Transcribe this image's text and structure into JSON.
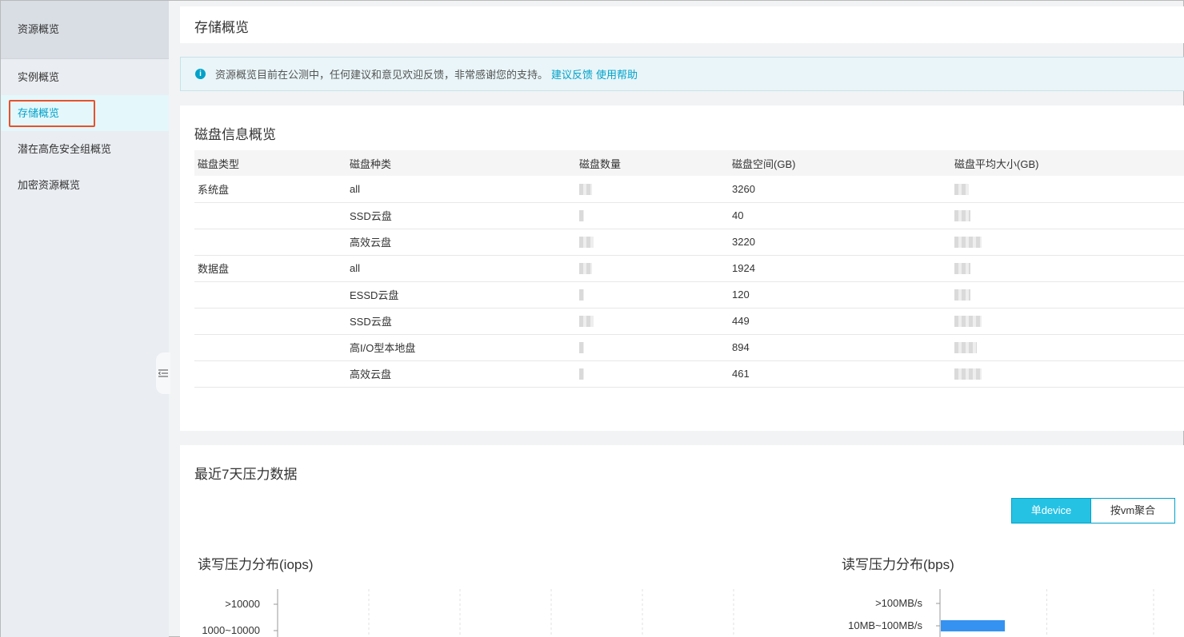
{
  "sidebar": {
    "title": "资源概览",
    "items": [
      {
        "label": "实例概览"
      },
      {
        "label": "存储概览"
      },
      {
        "label": "潜在高危安全组概览"
      },
      {
        "label": "加密资源概览"
      }
    ]
  },
  "page": {
    "title": "存储概览",
    "notice": {
      "text": "资源概览目前在公测中，任何建议和意见欢迎反馈，非常感谢您的支持。",
      "link1": "建议反馈",
      "link2": "使用帮助"
    }
  },
  "disk_overview": {
    "title": "磁盘信息概览",
    "headers": [
      "磁盘类型",
      "磁盘种类",
      "磁盘数量",
      "磁盘空间(GB)",
      "磁盘平均大小(GB)"
    ],
    "rows": [
      {
        "type": "系统盘",
        "kind": "all",
        "space": "3260"
      },
      {
        "type": "",
        "kind": "SSD云盘",
        "space": "40"
      },
      {
        "type": "",
        "kind": "高效云盘",
        "space": "3220"
      },
      {
        "type": "数据盘",
        "kind": "all",
        "space": "1924"
      },
      {
        "type": "",
        "kind": "ESSD云盘",
        "space": "120"
      },
      {
        "type": "",
        "kind": "SSD云盘",
        "space": "449"
      },
      {
        "type": "",
        "kind": "高I/O型本地盘",
        "space": "894"
      },
      {
        "type": "",
        "kind": "高效云盘",
        "space": "461"
      }
    ]
  },
  "pressure": {
    "title": "最近7天压力数据",
    "toggle": [
      "单device",
      "按vm聚合"
    ],
    "active_toggle": "单device"
  },
  "chart_data": [
    {
      "type": "bar",
      "title": "读写压力分布(iops)",
      "orientation": "horizontal",
      "categories": [
        ">10000",
        "1000~10000"
      ],
      "values": [
        0,
        0
      ]
    },
    {
      "type": "bar",
      "title": "读写压力分布(bps)",
      "orientation": "horizontal",
      "categories": [
        ">100MB/s",
        "10MB~100MB/s"
      ],
      "values": [
        0,
        0.3
      ],
      "color": "#3592f0"
    }
  ],
  "colors": {
    "accent": "#00a2ca",
    "highlight_border": "#e8512c"
  }
}
